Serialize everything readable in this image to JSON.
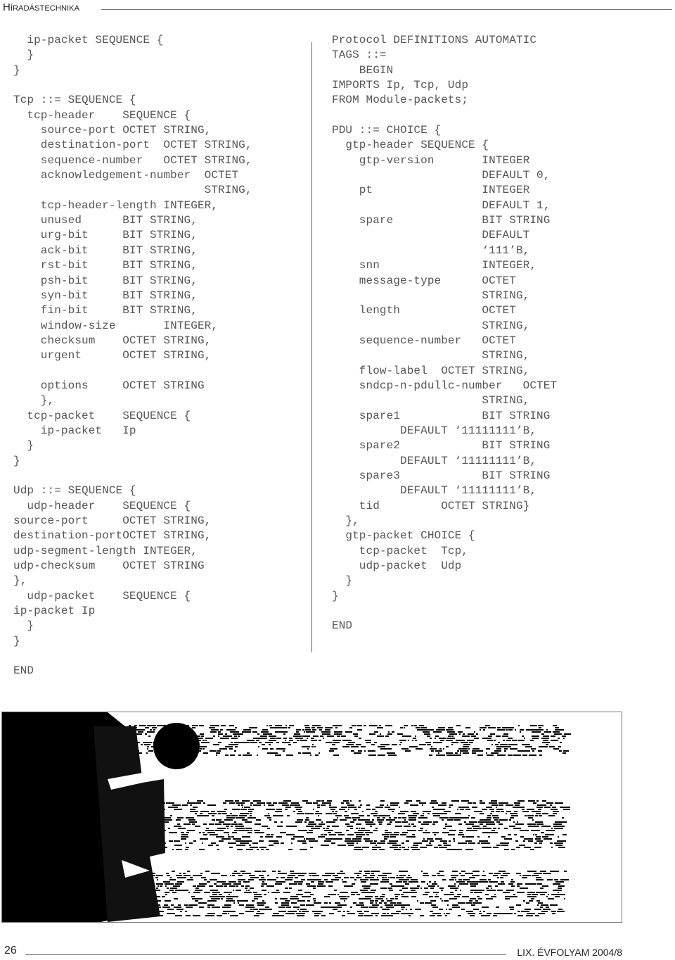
{
  "header": {
    "title_first_letter": "H",
    "title_rest": "ÍRADÁSTECHNIKA"
  },
  "code_left": {
    "lines": [
      "  ip-packet SEQUENCE {",
      "  }",
      "}",
      "",
      "Tcp ::= SEQUENCE {",
      "  tcp-header    SEQUENCE {",
      "    source-port OCTET STRING,",
      "    destination-port  OCTET STRING,",
      "    sequence-number   OCTET STRING,",
      "    acknowledgement-number  OCTET",
      "                            STRING,",
      "    tcp-header-length INTEGER,",
      "    unused      BIT STRING,",
      "    urg-bit     BIT STRING,",
      "    ack-bit     BIT STRING,",
      "    rst-bit     BIT STRING,",
      "    psh-bit     BIT STRING,",
      "    syn-bit     BIT STRING,",
      "    fin-bit     BIT STRING,",
      "    window-size       INTEGER,",
      "    checksum    OCTET STRING,",
      "    urgent      OCTET STRING,",
      "",
      "    options     OCTET STRING",
      "    },",
      "  tcp-packet    SEQUENCE {",
      "    ip-packet   Ip",
      "  }",
      "}",
      "",
      "Udp ::= SEQUENCE {",
      "  udp-header    SEQUENCE {",
      "source-port     OCTET STRING,",
      "destination-portOCTET STRING,",
      "udp-segment-length INTEGER,",
      "udp-checksum    OCTET STRING",
      "},",
      "  udp-packet    SEQUENCE {",
      "ip-packet Ip",
      "  }",
      "}",
      "",
      "END"
    ]
  },
  "code_right": {
    "lines": [
      "Protocol DEFINITIONS AUTOMATIC",
      "TAGS ::=",
      "    BEGIN",
      "IMPORTS Ip, Tcp, Udp",
      "FROM Module-packets;",
      "",
      "PDU ::= CHOICE {",
      "  gtp-header SEQUENCE {",
      "    gtp-version       INTEGER",
      "                      DEFAULT 0,",
      "    pt                INTEGER",
      "                      DEFAULT 1,",
      "    spare             BIT STRING",
      "                      DEFAULT",
      "                      ‘111’B,",
      "    snn               INTEGER,",
      "    message-type      OCTET",
      "                      STRING,",
      "    length            OCTET",
      "                      STRING,",
      "    sequence-number   OCTET",
      "                      STRING,",
      "    flow-label  OCTET STRING,",
      "    sndcp-n-pdullc-number   OCTET",
      "                      STRING,",
      "    spare1            BIT STRING",
      "          DEFAULT ‘11111111’B,",
      "    spare2            BIT STRING",
      "          DEFAULT ‘11111111’B,",
      "    spare3            BIT STRING",
      "          DEFAULT ‘11111111’B,",
      "    tid         OCTET STRING}",
      "  },",
      "  gtp-packet CHOICE {",
      "    tcp-packet  Tcp,",
      "    udp-packet  Udp",
      "  }",
      "}",
      "",
      "END"
    ]
  },
  "figure": {
    "description": "halftone black-and-white photo of a lattice tower with a dish antenna and horizontal noise bands"
  },
  "footer": {
    "page_number": "26",
    "issue": "LIX. ÉVFOLYAM 2004/8"
  }
}
